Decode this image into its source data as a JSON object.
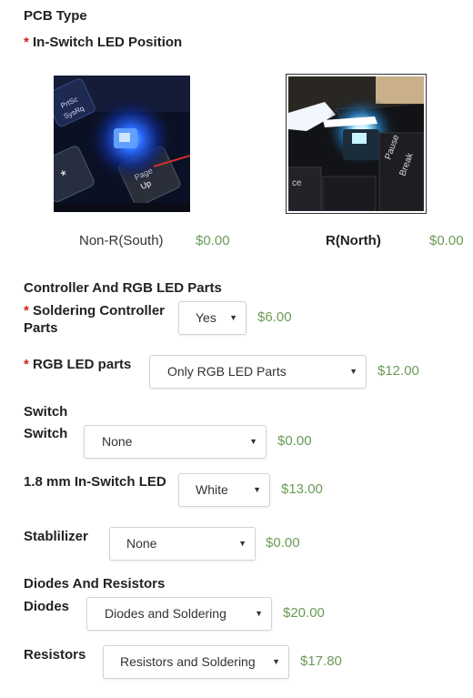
{
  "pcb_type": {
    "title": "PCB Type"
  },
  "led_position": {
    "required_mark": "*",
    "title": "In-Switch LED Position",
    "options": [
      {
        "label": "Non-R(South)",
        "price": "$0.00",
        "selected": false
      },
      {
        "label": "R(North)",
        "price": "$0.00",
        "selected": true
      }
    ]
  },
  "controller_section": {
    "title": "Controller And RGB LED Parts",
    "soldering": {
      "required_mark": "*",
      "label": "Soldering Controller Parts",
      "value": "Yes",
      "price": "$6.00"
    },
    "rgb": {
      "required_mark": "*",
      "label": "RGB LED parts",
      "value": "Only RGB LED Parts",
      "price": "$12.00"
    }
  },
  "switch_section": {
    "title": "Switch",
    "switch": {
      "label": "Switch",
      "value": "None",
      "price": "$0.00"
    },
    "led_18": {
      "label": "1.8 mm In-Switch LED",
      "value": "White",
      "price": "$13.00"
    },
    "stabilizer": {
      "label": "Stablilizer",
      "value": "None",
      "price": "$0.00"
    }
  },
  "diodes_section": {
    "title": "Diodes And Resistors",
    "diodes": {
      "label": "Diodes",
      "value": "Diodes and Soldering",
      "price": "$20.00"
    },
    "resistors": {
      "label": "Resistors",
      "value": "Resistors and Soldering",
      "price": "$17.80"
    }
  },
  "icons": {
    "caret": "chevron-down-icon",
    "required": "asterisk-icon"
  },
  "colors": {
    "price": "#6b9b56",
    "required": "#d21f1f",
    "selected_border": "#333333"
  }
}
